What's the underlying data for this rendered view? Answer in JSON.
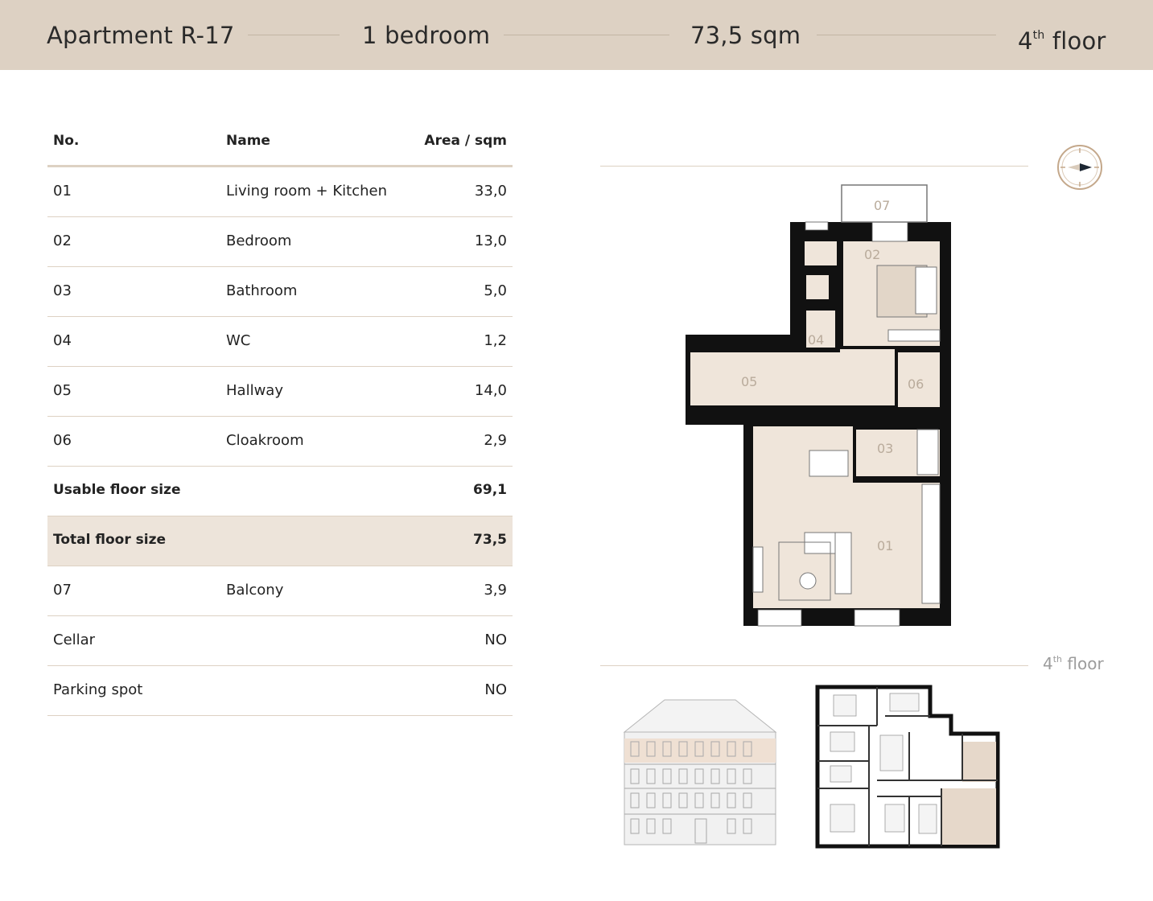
{
  "header": {
    "apartment": "Apartment R-17",
    "bedrooms": "1 bedroom",
    "area": "73,5 sqm",
    "floor_number": "4",
    "floor_suffix": "th",
    "floor_word": "floor"
  },
  "table": {
    "columns": [
      "No.",
      "Name",
      "Area / sqm"
    ],
    "rooms": [
      {
        "no": "01",
        "name": "Living room + Kitchen",
        "area": "33,0"
      },
      {
        "no": "02",
        "name": "Bedroom",
        "area": "13,0"
      },
      {
        "no": "03",
        "name": "Bathroom",
        "area": "5,0"
      },
      {
        "no": "04",
        "name": "WC",
        "area": "1,2"
      },
      {
        "no": "05",
        "name": "Hallway",
        "area": "14,0"
      },
      {
        "no": "06",
        "name": "Cloakroom",
        "area": "2,9"
      }
    ],
    "usable": {
      "label": "Usable floor size",
      "area": "69,1"
    },
    "total": {
      "label": "Total floor size",
      "area": "73,5"
    },
    "extras": [
      {
        "no": "07",
        "name": "Balcony",
        "area": "3,9"
      },
      {
        "no": "Cellar",
        "name": "",
        "area": "NO"
      },
      {
        "no": "Parking spot",
        "name": "",
        "area": "NO"
      }
    ]
  },
  "plan": {
    "room_labels": [
      "01",
      "02",
      "03",
      "04",
      "05",
      "06",
      "07"
    ],
    "floor_number": "4",
    "floor_suffix": "th",
    "floor_word": "floor"
  },
  "colors": {
    "header_band": "#ddd1c3",
    "highlight_row": "#ede4da",
    "room_fill": "#efe5da",
    "wall": "#111111",
    "accent_outline": "#b89a7c"
  },
  "icons": {
    "compass": "compass-icon"
  }
}
